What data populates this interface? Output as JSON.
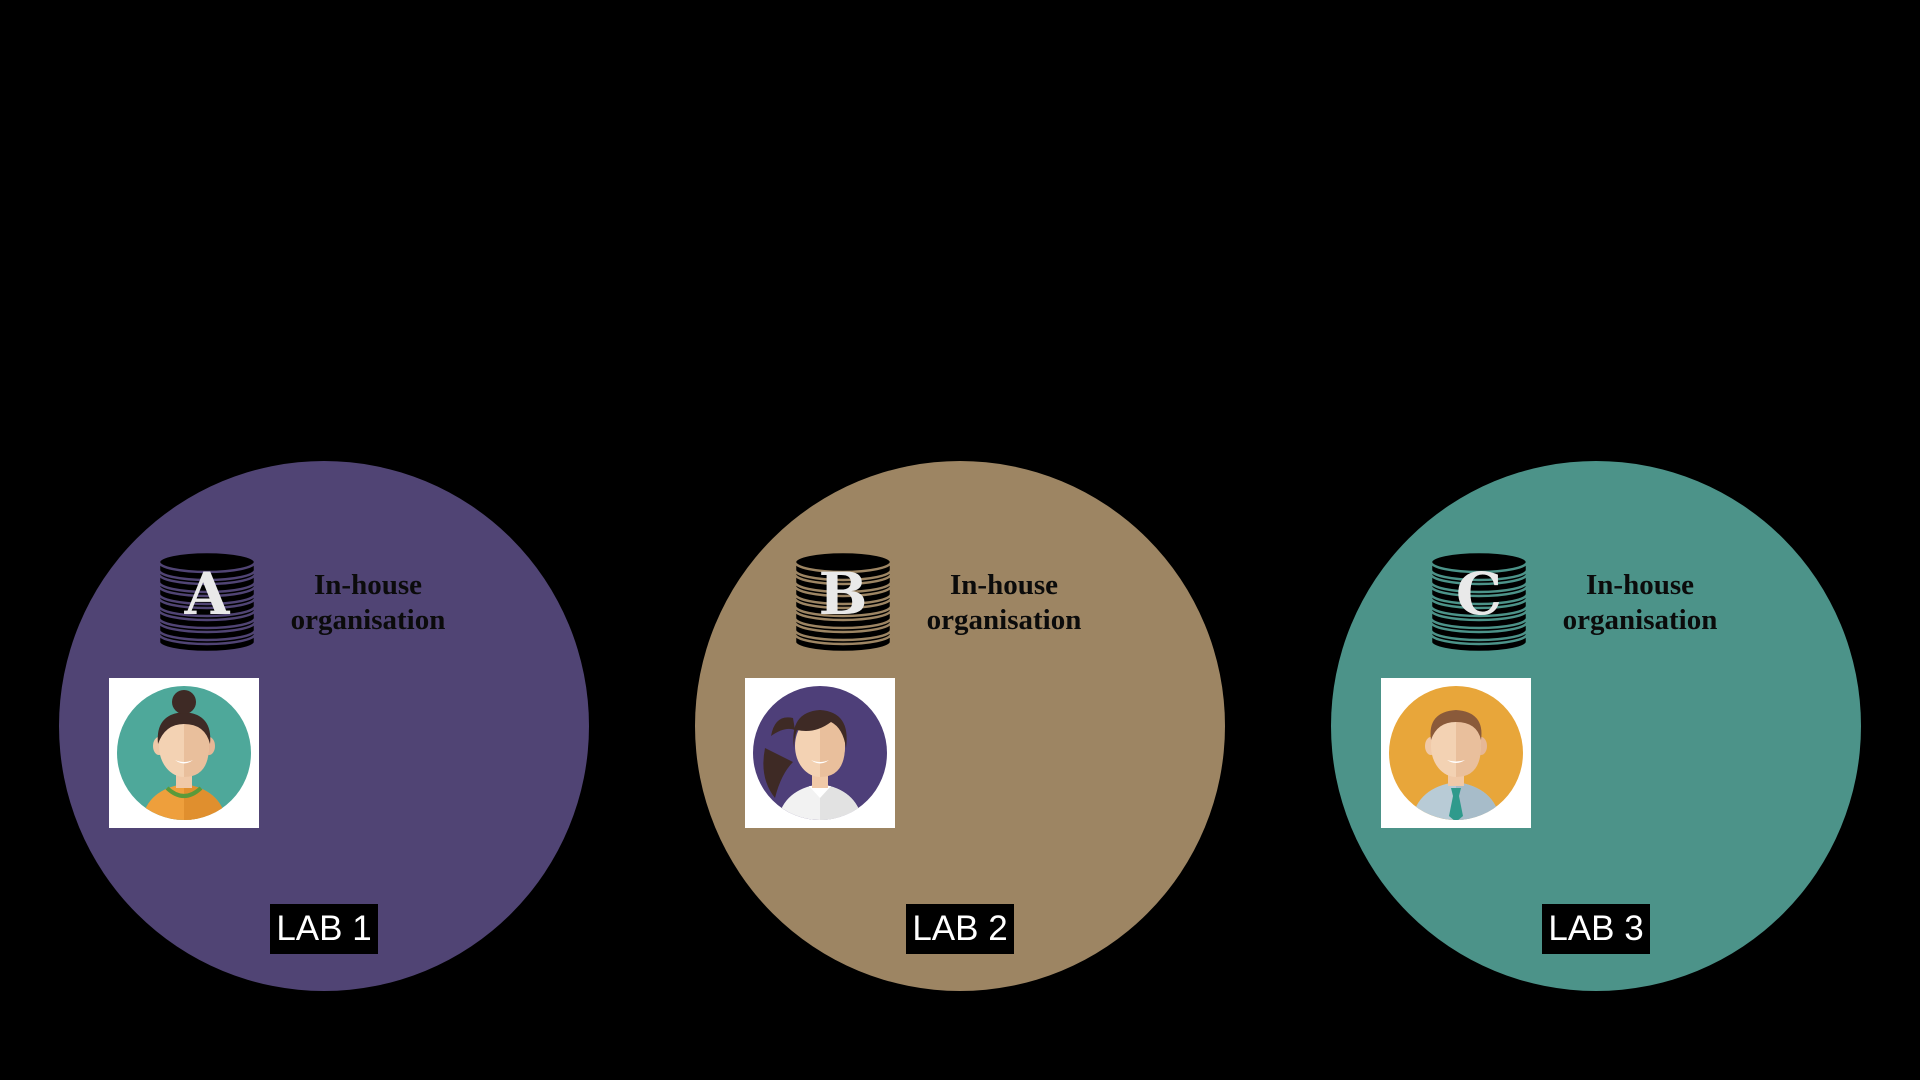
{
  "background_color": "#000000",
  "labs": [
    {
      "label": "LAB 1",
      "database_letter": "A",
      "caption_line1": "In-house",
      "caption_line2": "organisation",
      "circle_color": "#504474",
      "avatar": "woman-with-bun-icon",
      "avatar_bg": "#4ea89a"
    },
    {
      "label": "LAB 2",
      "database_letter": "B",
      "caption_line1": "In-house",
      "caption_line2": "organisation",
      "circle_color": "#9d8563",
      "avatar": "woman-with-ponytail-icon",
      "avatar_bg": "#4e3f79"
    },
    {
      "label": "LAB 3",
      "database_letter": "C",
      "caption_line1": "In-house",
      "caption_line2": "organisation",
      "circle_color": "#4c9389",
      "avatar": "man-with-tie-icon",
      "avatar_bg": "#e8a63a"
    }
  ]
}
